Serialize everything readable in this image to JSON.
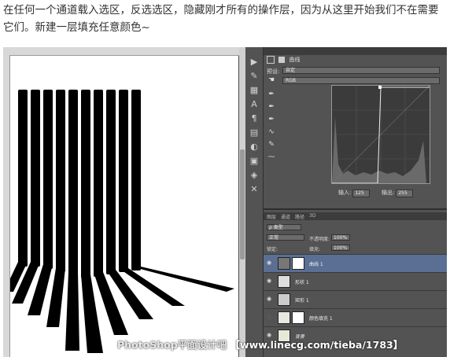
{
  "caption": "在任何一个通道载入选区，反选选区，隐藏刚才所有的操作层，因为从这里开始我们不在需要它们。新建一层填充任意颜色~",
  "properties": {
    "title": "曲线",
    "preset_label": "预设:",
    "preset_value": "自定",
    "channel_value": "RGB",
    "input_label": "输入:",
    "input_value": "125",
    "output_label": "输出:",
    "output_value": "255"
  },
  "layers_panel": {
    "tabs": [
      "图层",
      "通道",
      "路径",
      "3D"
    ],
    "kind_label": "类型",
    "blend_mode": "正常",
    "opacity_label": "不透明度:",
    "opacity_value": "100%",
    "lock_label": "锁定:",
    "fill_label": "填充:",
    "fill_value": "100%",
    "layers": [
      {
        "name": "曲线 1",
        "selected": true,
        "visible": true
      },
      {
        "name": "形状 1",
        "selected": false,
        "visible": true
      },
      {
        "name": "矩形 1",
        "selected": false,
        "visible": true
      },
      {
        "name": "颜色填充 1",
        "selected": false,
        "visible": false
      },
      {
        "name": "背景",
        "selected": false,
        "visible": true
      }
    ]
  },
  "watermark": {
    "site": "PhotoShop平面设计吧",
    "url": "【www.linecg.com/tieba/1783】"
  },
  "colors": {
    "panel_bg": "#535353",
    "selected_layer": "#5b6f94",
    "canvas_bg": "#ffffff",
    "shape_fill": "#000000"
  }
}
